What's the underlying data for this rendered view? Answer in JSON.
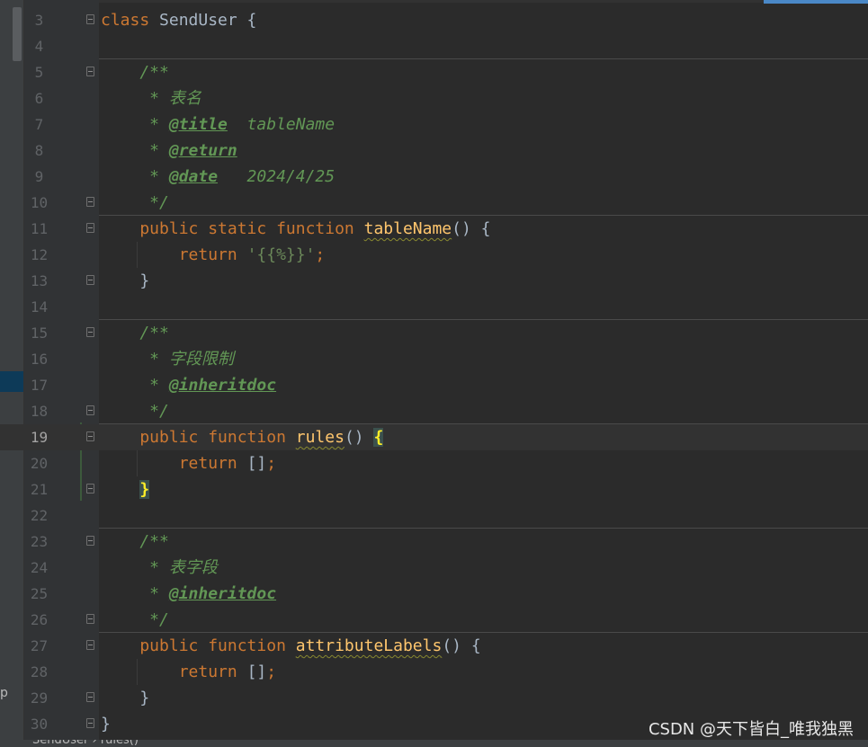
{
  "sidebar": {
    "partial_label": "p"
  },
  "lines": [
    {
      "no": "3",
      "segments": [
        [
          "kw",
          "class"
        ],
        [
          "pn",
          " SendUser {"
        ]
      ],
      "fold": true
    },
    {
      "no": "4",
      "segments": []
    },
    {
      "no": "5",
      "segments": [
        [
          "cm",
          "    /**"
        ]
      ],
      "fold": true,
      "sep": true
    },
    {
      "no": "6",
      "segments": [
        [
          "cm",
          "     * 表名"
        ]
      ]
    },
    {
      "no": "7",
      "segments": [
        [
          "cm",
          "     * "
        ],
        [
          "tag",
          "@title"
        ],
        [
          "cm",
          "  tableName"
        ]
      ]
    },
    {
      "no": "8",
      "segments": [
        [
          "cm",
          "     * "
        ],
        [
          "tag",
          "@return"
        ]
      ]
    },
    {
      "no": "9",
      "segments": [
        [
          "cm",
          "     * "
        ],
        [
          "tag",
          "@date"
        ],
        [
          "cm",
          "   2024/4/25"
        ]
      ]
    },
    {
      "no": "10",
      "segments": [
        [
          "cm",
          "     */"
        ]
      ],
      "fold": true
    },
    {
      "no": "11",
      "segments": [
        [
          "kw",
          "    public static function "
        ],
        [
          "fn",
          "tableName"
        ],
        [
          "pn",
          "() {"
        ]
      ],
      "fold": true,
      "sep": true
    },
    {
      "no": "12",
      "segments": [
        [
          "kw",
          "        return "
        ],
        [
          "str",
          "'{{%}}'"
        ],
        [
          "kw",
          ";"
        ]
      ],
      "guide": true
    },
    {
      "no": "13",
      "segments": [
        [
          "pn",
          "    }"
        ]
      ],
      "fold": true
    },
    {
      "no": "14",
      "segments": []
    },
    {
      "no": "15",
      "segments": [
        [
          "cm",
          "    /**"
        ]
      ],
      "fold": true,
      "sep": true
    },
    {
      "no": "16",
      "segments": [
        [
          "cm",
          "     * 字段限制"
        ]
      ]
    },
    {
      "no": "17",
      "segments": [
        [
          "cm",
          "     * "
        ],
        [
          "tag",
          "@inheritdoc"
        ]
      ]
    },
    {
      "no": "18",
      "segments": [
        [
          "cm",
          "     */"
        ]
      ],
      "fold": true
    },
    {
      "no": "19",
      "segments": [
        [
          "kw",
          "    public function "
        ],
        [
          "fn",
          "rules"
        ],
        [
          "pn",
          "() "
        ],
        [
          "hl",
          "{"
        ]
      ],
      "fold": true,
      "sep": true,
      "current": true
    },
    {
      "no": "20",
      "segments": [
        [
          "kw",
          "        return "
        ],
        [
          "pn",
          "[]"
        ],
        [
          "kw",
          ";"
        ]
      ],
      "guide": true
    },
    {
      "no": "21",
      "segments": [
        [
          "pn",
          "    "
        ],
        [
          "hl",
          "}"
        ]
      ],
      "fold": true
    },
    {
      "no": "22",
      "segments": []
    },
    {
      "no": "23",
      "segments": [
        [
          "cm",
          "    /**"
        ]
      ],
      "fold": true,
      "sep": true
    },
    {
      "no": "24",
      "segments": [
        [
          "cm",
          "     * 表字段"
        ]
      ]
    },
    {
      "no": "25",
      "segments": [
        [
          "cm",
          "     * "
        ],
        [
          "tag",
          "@inheritdoc"
        ]
      ]
    },
    {
      "no": "26",
      "segments": [
        [
          "cm",
          "     */"
        ]
      ],
      "fold": true
    },
    {
      "no": "27",
      "segments": [
        [
          "kw",
          "    public function "
        ],
        [
          "fnu",
          "attributeLabels"
        ],
        [
          "pn",
          "() {"
        ]
      ],
      "fold": true,
      "sep": true
    },
    {
      "no": "28",
      "segments": [
        [
          "kw",
          "        return "
        ],
        [
          "pn",
          "[]"
        ],
        [
          "kw",
          ";"
        ]
      ],
      "guide": true
    },
    {
      "no": "29",
      "segments": [
        [
          "pn",
          "    }"
        ]
      ],
      "fold": true
    },
    {
      "no": "30",
      "segments": [
        [
          "pn",
          "}"
        ]
      ],
      "fold": true
    }
  ],
  "breadcrumb": "SendUser › rules()",
  "watermark": "CSDN @天下皆白_唯我独黑"
}
